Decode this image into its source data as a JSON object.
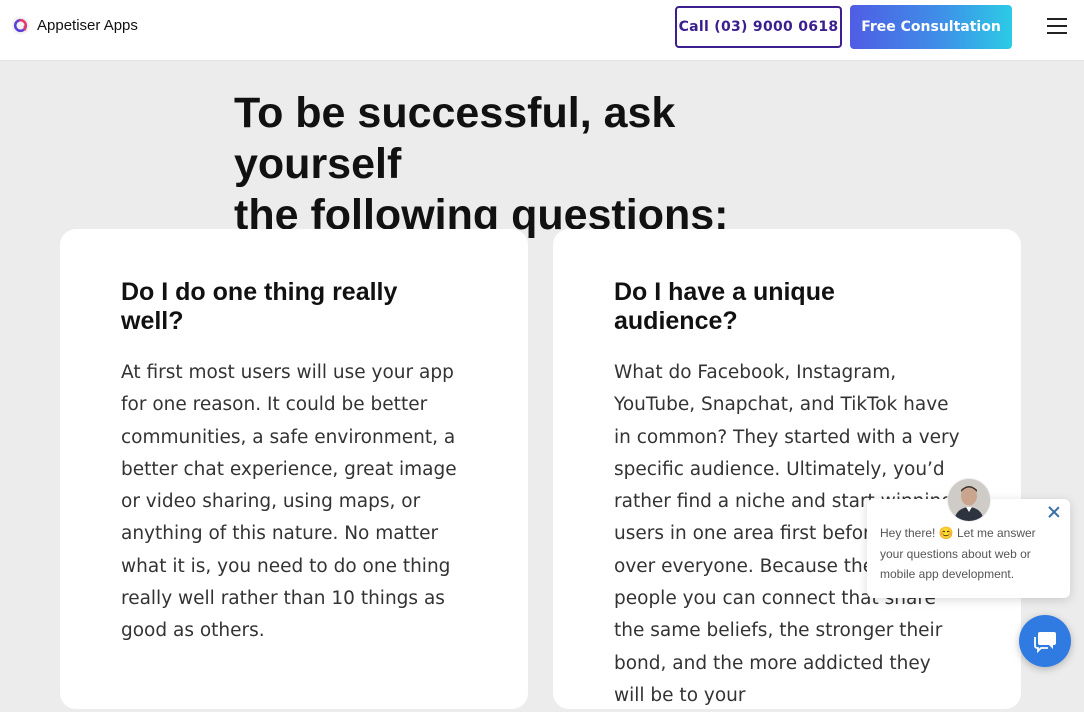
{
  "header": {
    "logo_text": "Appetiser Apps",
    "call_label": "Call (03) 9000 0618",
    "consult_label": "Free Consultation"
  },
  "section": {
    "title_line1": "To be successful, ask yourself",
    "title_line2": "the following questions:"
  },
  "cards": [
    {
      "heading": "Do I do one thing really well?",
      "body": "At first most users will use your app for one reason. It could be better communities, a safe environment, a better chat experience, great image or video sharing, using maps, or anything of this nature. No matter what it is, you need to do one thing really well rather than 10 things as good as others."
    },
    {
      "heading": "Do I have a unique audience?",
      "body": "What do Facebook, Instagram, YouTube, Snapchat, and TikTok have in common? They started with a very specific audience. Ultimately, you’d rather find a niche and start winning users in one area first before taking over everyone. Because the more people you can connect that share the same beliefs, the stronger their bond, and the more addicted they will be to your"
    }
  ],
  "chat": {
    "message": "Hey there! 😊 Let me answer your questions about web or mobile app development."
  },
  "colors": {
    "primary_purple": "#3b1f8f",
    "gradient_start": "#4f5de4",
    "gradient_end": "#2ccbe6",
    "chat_blue": "#2f7be2",
    "page_bg": "#ececec"
  }
}
